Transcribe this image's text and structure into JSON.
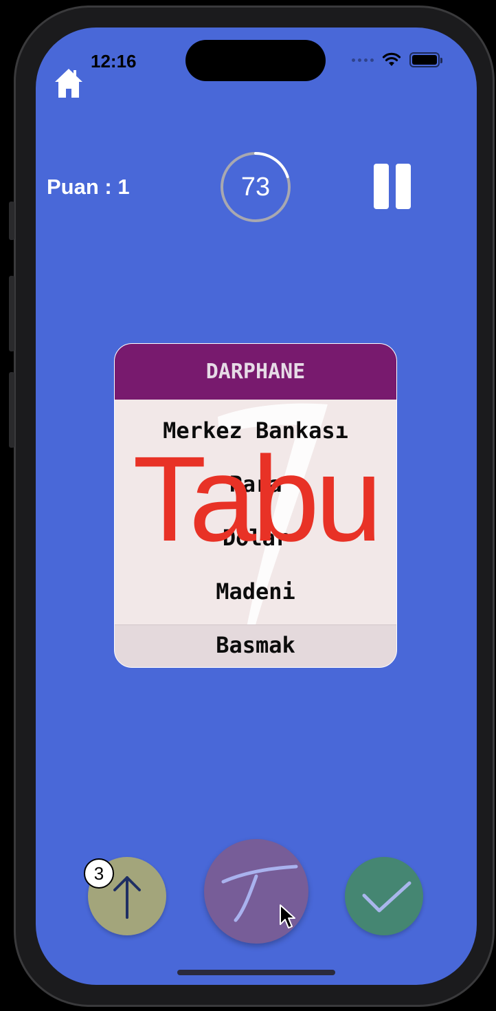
{
  "status_bar": {
    "time": "12:16"
  },
  "header": {
    "score_text": "Puan : 1",
    "timer_value": "73",
    "timer_progress": 0.2
  },
  "card": {
    "target_word": "DARPHANE",
    "taboo_words": [
      "Merkez Bankası",
      "Para",
      "Dolar",
      "Madeni",
      "Basmak"
    ],
    "overlay_text": "Tabu"
  },
  "actions": {
    "pass_count": "3"
  },
  "colors": {
    "background": "#4968d8",
    "card_header": "#781a6e",
    "card_body": "#f2e8e8",
    "overlay": "#e83226",
    "pass_button": "#a3a57b",
    "taboo_button": "#775d98",
    "correct_button": "#458672"
  },
  "icons": {
    "home": "home-icon",
    "pause": "pause-icon",
    "pass": "arrow-up-icon",
    "taboo": "taboo-t-icon",
    "correct": "checkmark-icon"
  }
}
